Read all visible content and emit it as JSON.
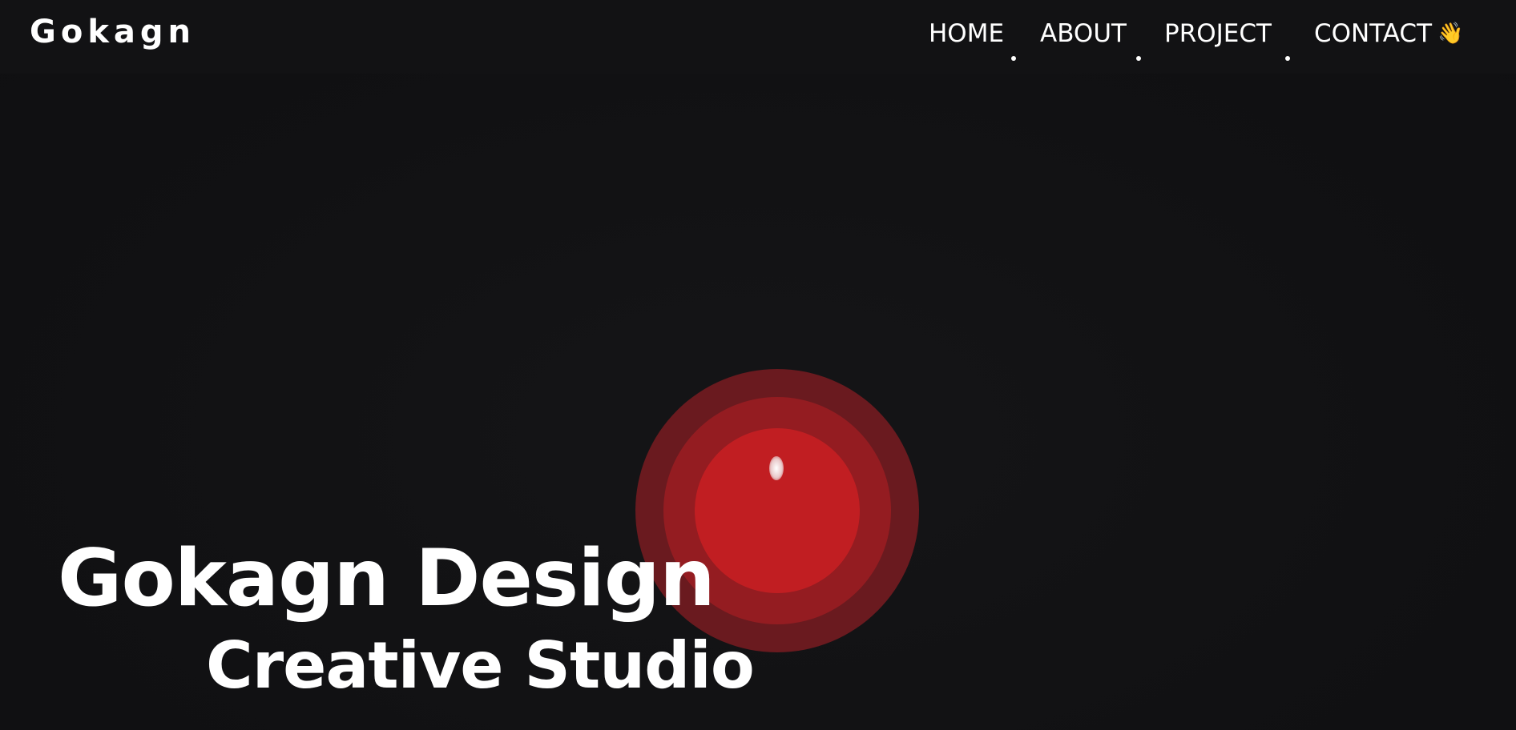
{
  "brand": {
    "logo": "Gokagn"
  },
  "nav": {
    "items": [
      {
        "label": "HOME"
      },
      {
        "label": "ABOUT"
      },
      {
        "label": "PROJECT"
      },
      {
        "label": "CONTACT"
      }
    ],
    "contact_icon": "👋",
    "contact_icon_name": "waving-hand-icon"
  },
  "hero": {
    "title": "Gokagn Design",
    "subtitle": "Creative Studio"
  },
  "colors": {
    "background": "#111113",
    "text": "#ffffff",
    "orb_outer": "#6a1a1f",
    "orb_middle": "#941c21",
    "orb_inner": "#c11e22"
  }
}
